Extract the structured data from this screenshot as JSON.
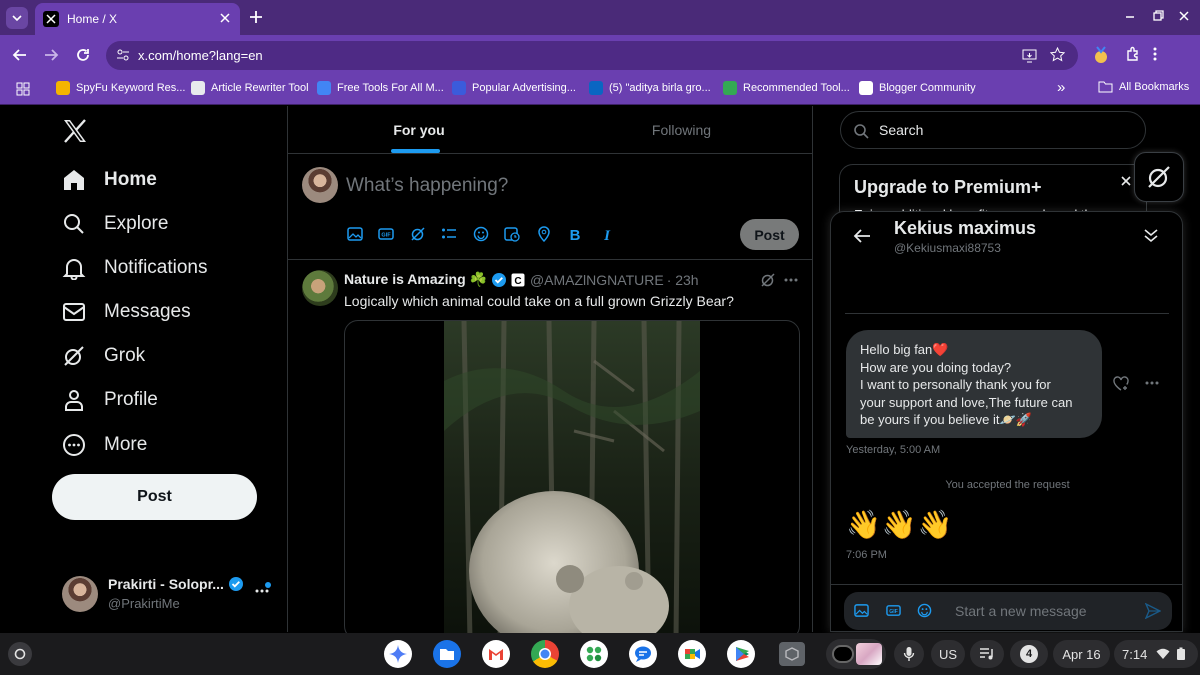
{
  "browser": {
    "tab_title": "Home / X",
    "url": "x.com/home?lang=en",
    "bookmarks": [
      {
        "label": "SpyFu Keyword Res...",
        "color": "#f4b400"
      },
      {
        "label": "Article Rewriter Tool",
        "color": "#e8eaed"
      },
      {
        "label": "Free Tools For All M...",
        "color": "#4285f4"
      },
      {
        "label": "Popular Advertising...",
        "color": "#3b5bdb"
      },
      {
        "label": "(5) \"aditya birla gro...",
        "color": "#0a66c2"
      },
      {
        "label": "Recommended Tool...",
        "color": "#34a853"
      },
      {
        "label": "Blogger Community",
        "color": "#ffffff"
      }
    ],
    "all_bookmarks": "All Bookmarks",
    "more_bookmarks": "»"
  },
  "nav": {
    "items": [
      {
        "label": "Home",
        "icon": "home-icon"
      },
      {
        "label": "Explore",
        "icon": "search-icon"
      },
      {
        "label": "Notifications",
        "icon": "bell-icon"
      },
      {
        "label": "Messages",
        "icon": "mail-icon"
      },
      {
        "label": "Grok",
        "icon": "grok-icon"
      },
      {
        "label": "Profile",
        "icon": "person-icon"
      },
      {
        "label": "More",
        "icon": "more-circle-icon"
      }
    ],
    "post_label": "Post",
    "account": {
      "name": "Prakirti - Solopr...",
      "handle": "@PrakirtiMe"
    }
  },
  "feed": {
    "tabs": [
      "For you",
      "Following"
    ],
    "compose_placeholder": "What’s happening?",
    "compose_post_label": "Post",
    "tweet": {
      "author": "Nature is Amazing ☘️",
      "handle": "@AMAZlNGNATURE",
      "time": "· 23h",
      "text": "Logically which animal could take on a full grown Grizzly Bear?"
    }
  },
  "sidebar": {
    "search_placeholder": "Search",
    "premium_title": "Upgrade to Premium+",
    "premium_sub": "Enjoy additional benefits, zero ads and the"
  },
  "dm": {
    "name": "Kekius maximus",
    "handle": "@Kekiusmaxi88753",
    "message_lines": [
      "Hello big fan❤️",
      "How are you doing today?",
      "I want to personally thank you for",
      "your support and love,The future can",
      "be yours if you believe it🪐🚀"
    ],
    "message_time": "Yesterday, 5:00 AM",
    "system_note": "You accepted the request",
    "emoji_message": "👋👋👋",
    "emoji_time": "7:06 PM",
    "input_placeholder": "Start a new message"
  },
  "shelf": {
    "language": "US",
    "notif_count": "4",
    "date": "Apr 16",
    "time": "7:14"
  },
  "colors": {
    "accent_blue": "#1d9bf0",
    "chrome_purple": "#6a3fb0",
    "tabstrip_purple": "#4a2a78"
  }
}
